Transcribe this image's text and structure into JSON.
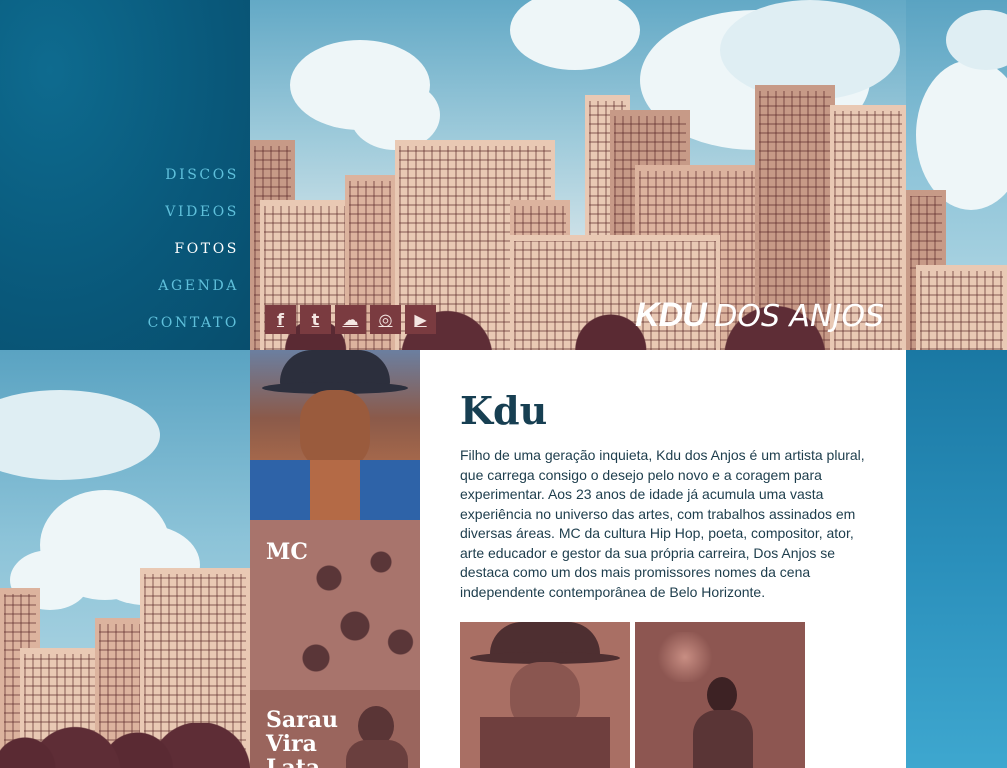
{
  "nav": {
    "items": [
      {
        "label": "DISCOS",
        "active": false
      },
      {
        "label": "VIDEOS",
        "active": false
      },
      {
        "label": "FOTOS",
        "active": true
      },
      {
        "label": "AGENDA",
        "active": false
      },
      {
        "label": "CONTATO",
        "active": false
      }
    ]
  },
  "header": {
    "logo_bold": "KDU",
    "logo_light": "DOS ANJOS",
    "social": [
      {
        "icon": "facebook-icon",
        "glyph": "f"
      },
      {
        "icon": "twitter-icon",
        "glyph": "t"
      },
      {
        "icon": "soundcloud-icon",
        "glyph": "☁"
      },
      {
        "icon": "instagram-icon",
        "glyph": "◎"
      },
      {
        "icon": "youtube-icon",
        "glyph": "▶"
      }
    ]
  },
  "thumbs": {
    "mc_label": "MC",
    "sarau_label_1": "Sarau",
    "sarau_label_2": "Vira",
    "sarau_label_3": "Lata"
  },
  "content": {
    "title": "Kdu",
    "body": "Filho de uma geração inquieta, Kdu dos Anjos é um artista plural, que carrega consigo o desejo pelo novo e a coragem para experimentar. Aos 23 anos de idade já acumula uma vasta experiência no universo das artes, com trabalhos assinados em diversas áreas. MC da cultura Hip Hop, poeta, compositor, ator, arte educador e gestor da sua própria carreira, Dos Anjos se destaca como um dos mais promissores nomes da cena independente contemporânea de Belo Horizonte."
  },
  "colors": {
    "nav_bg": "#09587a",
    "nav_link": "#5fc0db",
    "nav_active": "#ffffff",
    "title": "#173f52",
    "social_bg": "#7a3b40"
  }
}
